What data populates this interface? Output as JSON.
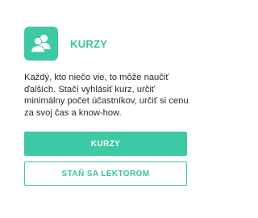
{
  "colors": {
    "accent": "#3cc9a3",
    "text": "#2a2a2a"
  },
  "card": {
    "icon": "people-icon",
    "title": "KURZY",
    "description": "Každý, kto niečo vie, to môže naučiť ďalších. Stačí vyhlásiť kurz, určiť minimálny počet účastníkov, určiť si cenu za svoj čas a know-how.",
    "primary_button": "KURZY",
    "secondary_button": "STAŇ SA LEKTOROM"
  }
}
